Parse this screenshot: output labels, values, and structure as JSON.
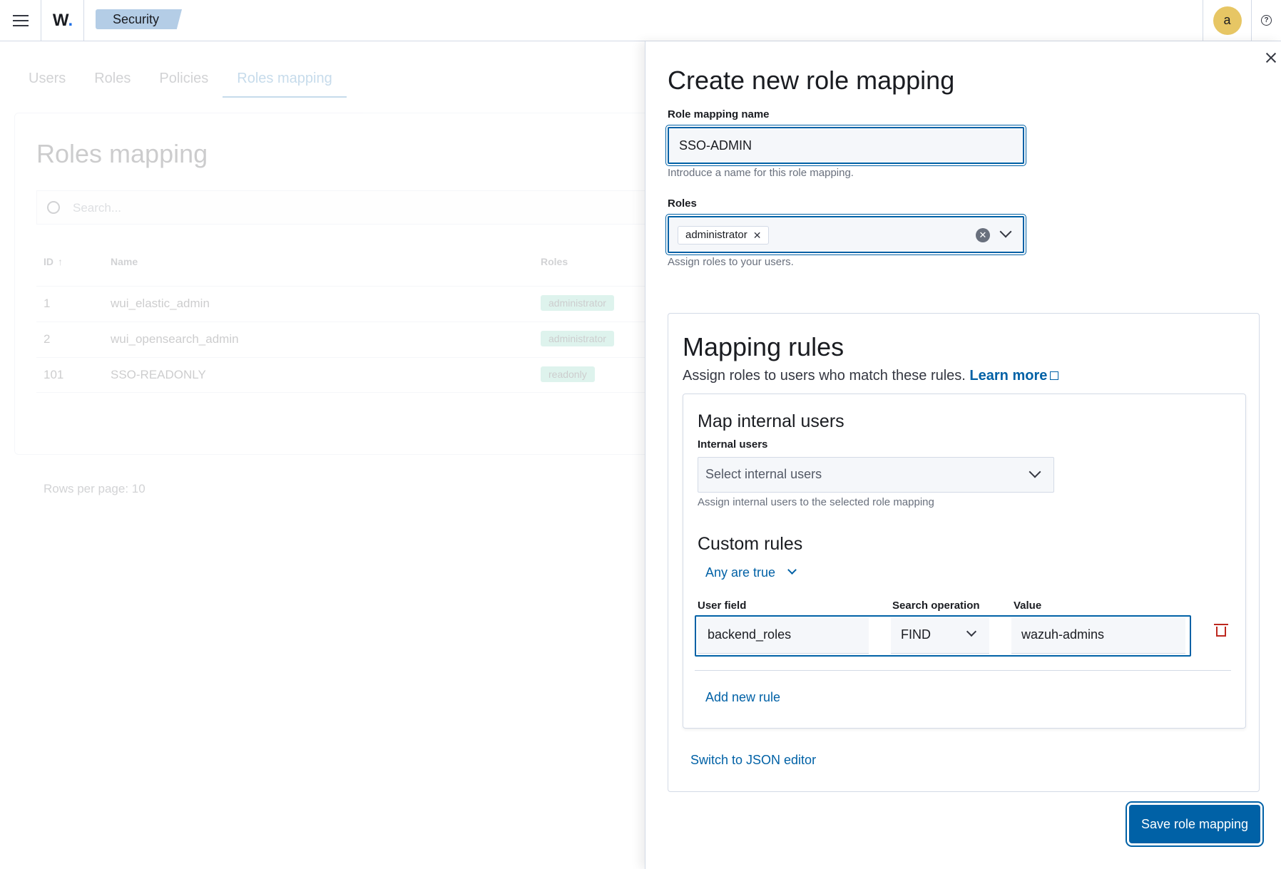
{
  "header": {
    "logo_text": "W",
    "logo_dot": ".",
    "breadcrumb": "Security",
    "avatar_initial": "a",
    "help_glyph": "?",
    "accent_color": "#0061a6"
  },
  "background": {
    "tabs": [
      "Users",
      "Roles",
      "Policies",
      "Roles mapping"
    ],
    "active_tab": "Roles mapping",
    "panel_title": "Roles mapping",
    "search_placeholder": "Search...",
    "table": {
      "headers": [
        "ID",
        "Name",
        "Roles"
      ],
      "rows": [
        {
          "id": "1",
          "name": "wui_elastic_admin",
          "role": "administrator"
        },
        {
          "id": "2",
          "name": "wui_opensearch_admin",
          "role": "administrator"
        },
        {
          "id": "101",
          "name": "SSO-READONLY",
          "role": "readonly"
        }
      ]
    },
    "rows_per_page": "Rows per page: 10"
  },
  "flyout": {
    "title": "Create new role mapping",
    "name_label": "Role mapping name",
    "name_value": "SSO-ADMIN",
    "name_help": "Introduce a name for this role mapping.",
    "roles_label": "Roles",
    "roles_selected": "administrator",
    "roles_help": "Assign roles to your users.",
    "mapping_rules": {
      "title": "Mapping rules",
      "description": "Assign roles to users who match these rules.",
      "learn_more": "Learn more",
      "internal_users": {
        "title": "Map internal users",
        "label": "Internal users",
        "placeholder": "Select internal users",
        "help": "Assign internal users to the selected role mapping"
      },
      "custom_rules": {
        "title": "Custom rules",
        "operator": "Any are true",
        "col_user_field": "User field",
        "col_search_op": "Search operation",
        "col_value": "Value",
        "rule": {
          "user_field": "backend_roles",
          "operation": "FIND",
          "value": "wazuh-admins"
        },
        "add_rule": "Add new rule"
      },
      "json_editor": "Switch to JSON editor"
    },
    "save_button": "Save role mapping"
  }
}
